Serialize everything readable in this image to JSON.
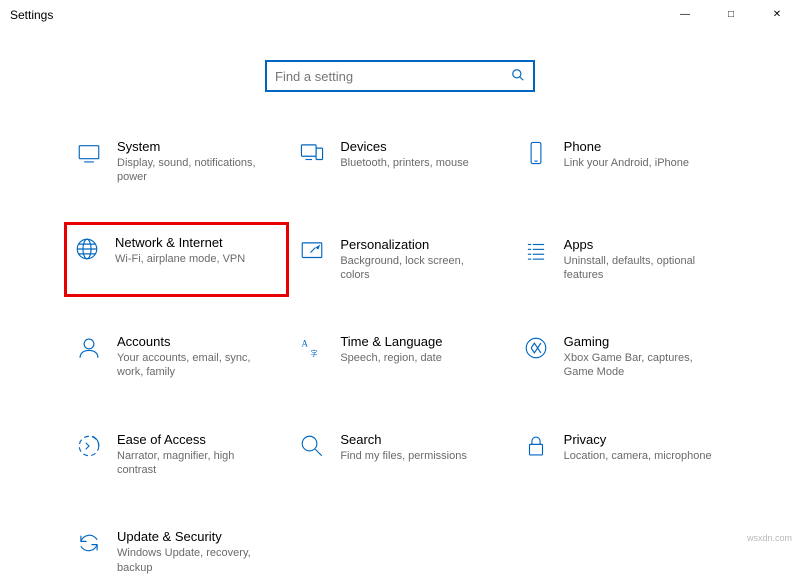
{
  "window": {
    "title": "Settings",
    "controls": {
      "minimize": "—",
      "maximize": "□",
      "close": "✕"
    }
  },
  "search": {
    "placeholder": "Find a setting"
  },
  "tiles": [
    {
      "title": "System",
      "desc": "Display, sound, notifications, power",
      "icon": "system",
      "highlight": false
    },
    {
      "title": "Devices",
      "desc": "Bluetooth, printers, mouse",
      "icon": "devices",
      "highlight": false
    },
    {
      "title": "Phone",
      "desc": "Link your Android, iPhone",
      "icon": "phone",
      "highlight": false
    },
    {
      "title": "Network & Internet",
      "desc": "Wi-Fi, airplane mode, VPN",
      "icon": "network",
      "highlight": true
    },
    {
      "title": "Personalization",
      "desc": "Background, lock screen, colors",
      "icon": "personalization",
      "highlight": false
    },
    {
      "title": "Apps",
      "desc": "Uninstall, defaults, optional features",
      "icon": "apps",
      "highlight": false
    },
    {
      "title": "Accounts",
      "desc": "Your accounts, email, sync, work, family",
      "icon": "accounts",
      "highlight": false
    },
    {
      "title": "Time & Language",
      "desc": "Speech, region, date",
      "icon": "time",
      "highlight": false
    },
    {
      "title": "Gaming",
      "desc": "Xbox Game Bar, captures, Game Mode",
      "icon": "gaming",
      "highlight": false
    },
    {
      "title": "Ease of Access",
      "desc": "Narrator, magnifier, high contrast",
      "icon": "ease",
      "highlight": false
    },
    {
      "title": "Search",
      "desc": "Find my files, permissions",
      "icon": "search",
      "highlight": false
    },
    {
      "title": "Privacy",
      "desc": "Location, camera, microphone",
      "icon": "privacy",
      "highlight": false
    },
    {
      "title": "Update & Security",
      "desc": "Windows Update, recovery, backup",
      "icon": "update",
      "highlight": false
    }
  ],
  "watermark": "wsxdn.com"
}
